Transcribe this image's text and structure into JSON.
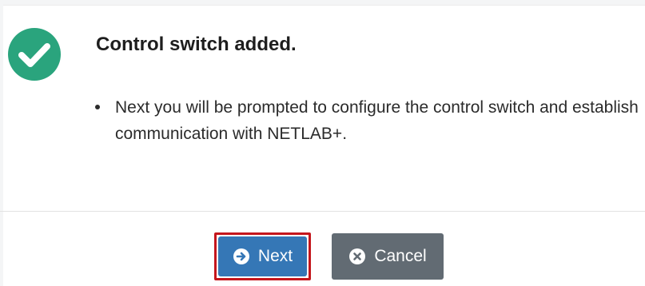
{
  "dialog": {
    "title": "Control switch added.",
    "status_icon": "check-circle-icon",
    "messages": [
      "Next you will be prompted to configure the control switch and establish communication with NETLAB+."
    ]
  },
  "footer": {
    "next_label": "Next",
    "next_icon": "arrow-circle-right-icon",
    "cancel_label": "Cancel",
    "cancel_icon": "times-circle-icon"
  },
  "colors": {
    "success": "#2aa47d",
    "primary": "#3577b6",
    "secondary": "#626b73",
    "highlight": "#c4161c"
  }
}
